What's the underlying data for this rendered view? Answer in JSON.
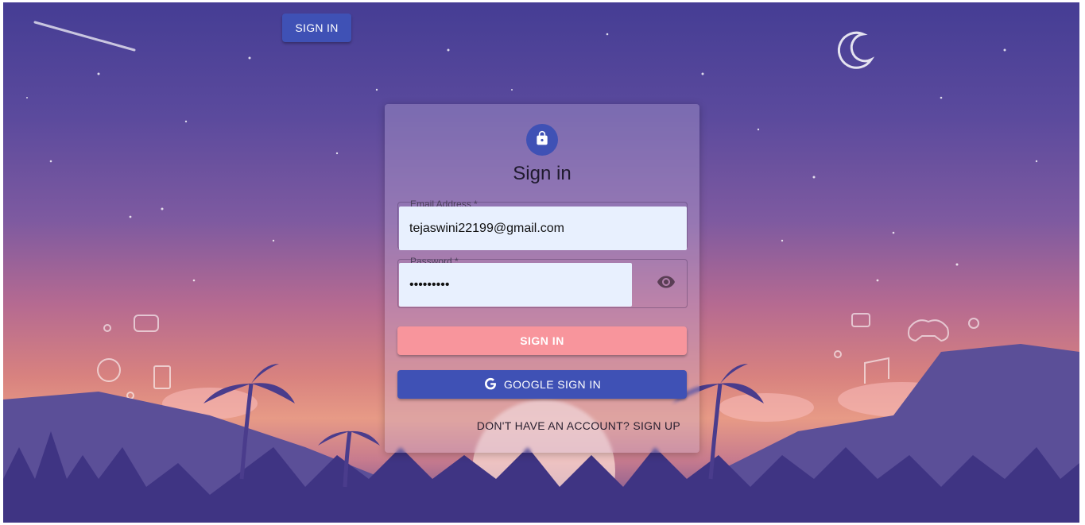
{
  "header": {
    "sign_in_button": "SIGN IN"
  },
  "form": {
    "title": "Sign in",
    "email": {
      "label": "Email Address *",
      "value": "tejaswini22199@gmail.com"
    },
    "password": {
      "label": "Password *",
      "value": "•••••••••"
    },
    "sign_in_button": "SIGN IN",
    "google_button": "GOOGLE SIGN IN",
    "signup_link": "DON'T HAVE AN ACCOUNT? SIGN UP"
  },
  "icons": {
    "lock": "lock-icon",
    "eye": "eye-icon",
    "google": "google-icon"
  },
  "colors": {
    "primary": "#3f51b5",
    "sign_in_button": "#f8959c",
    "input_background": "#e8f0fe"
  }
}
